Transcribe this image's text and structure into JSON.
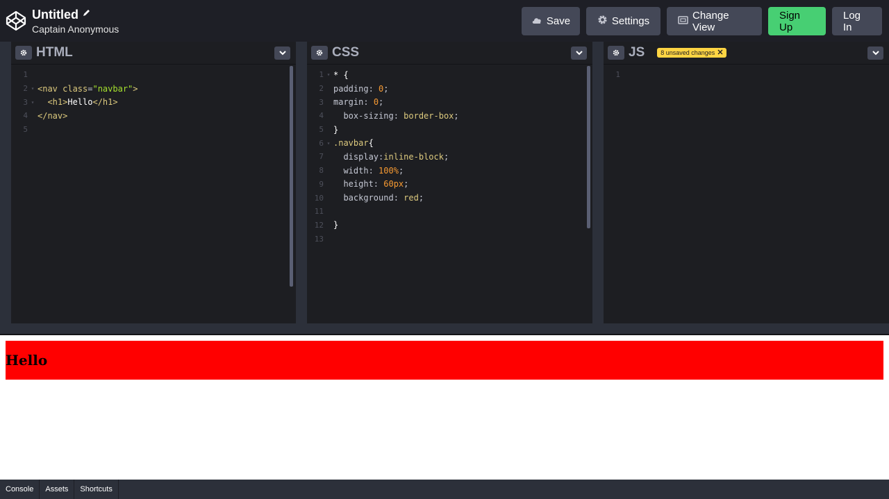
{
  "header": {
    "title": "Untitled",
    "author": "Captain Anonymous",
    "buttons": {
      "save": "Save",
      "settings": "Settings",
      "change_view": "Change View",
      "sign_up": "Sign Up",
      "log_in": "Log In"
    }
  },
  "editors": {
    "html": {
      "label": "HTML",
      "lines": [
        {
          "n": "1",
          "fold": ""
        },
        {
          "n": "2",
          "fold": "▾"
        },
        {
          "n": "3",
          "fold": "▾"
        },
        {
          "n": "4",
          "fold": ""
        },
        {
          "n": "5",
          "fold": ""
        }
      ]
    },
    "css": {
      "label": "CSS",
      "lines": [
        {
          "n": "1",
          "fold": "▾"
        },
        {
          "n": "2",
          "fold": ""
        },
        {
          "n": "3",
          "fold": ""
        },
        {
          "n": "4",
          "fold": ""
        },
        {
          "n": "5",
          "fold": ""
        },
        {
          "n": "6",
          "fold": "▾"
        },
        {
          "n": "7",
          "fold": ""
        },
        {
          "n": "8",
          "fold": ""
        },
        {
          "n": "9",
          "fold": ""
        },
        {
          "n": "10",
          "fold": ""
        },
        {
          "n": "11",
          "fold": ""
        },
        {
          "n": "12",
          "fold": ""
        },
        {
          "n": "13",
          "fold": ""
        }
      ]
    },
    "js": {
      "label": "JS",
      "unsaved_badge": "8 unsaved changes",
      "lines": [
        {
          "n": "1",
          "fold": ""
        }
      ]
    }
  },
  "preview": {
    "heading": "Hello",
    "navbar_color": "#ff0000"
  },
  "footer": {
    "tabs": [
      "Console",
      "Assets",
      "Shortcuts"
    ]
  },
  "colors": {
    "header_bg": "#1e1f26",
    "editor_bg": "#1d1e22",
    "button_bg": "#444857",
    "signup_bg": "#47cf73",
    "badge_bg": "#ffd543"
  }
}
